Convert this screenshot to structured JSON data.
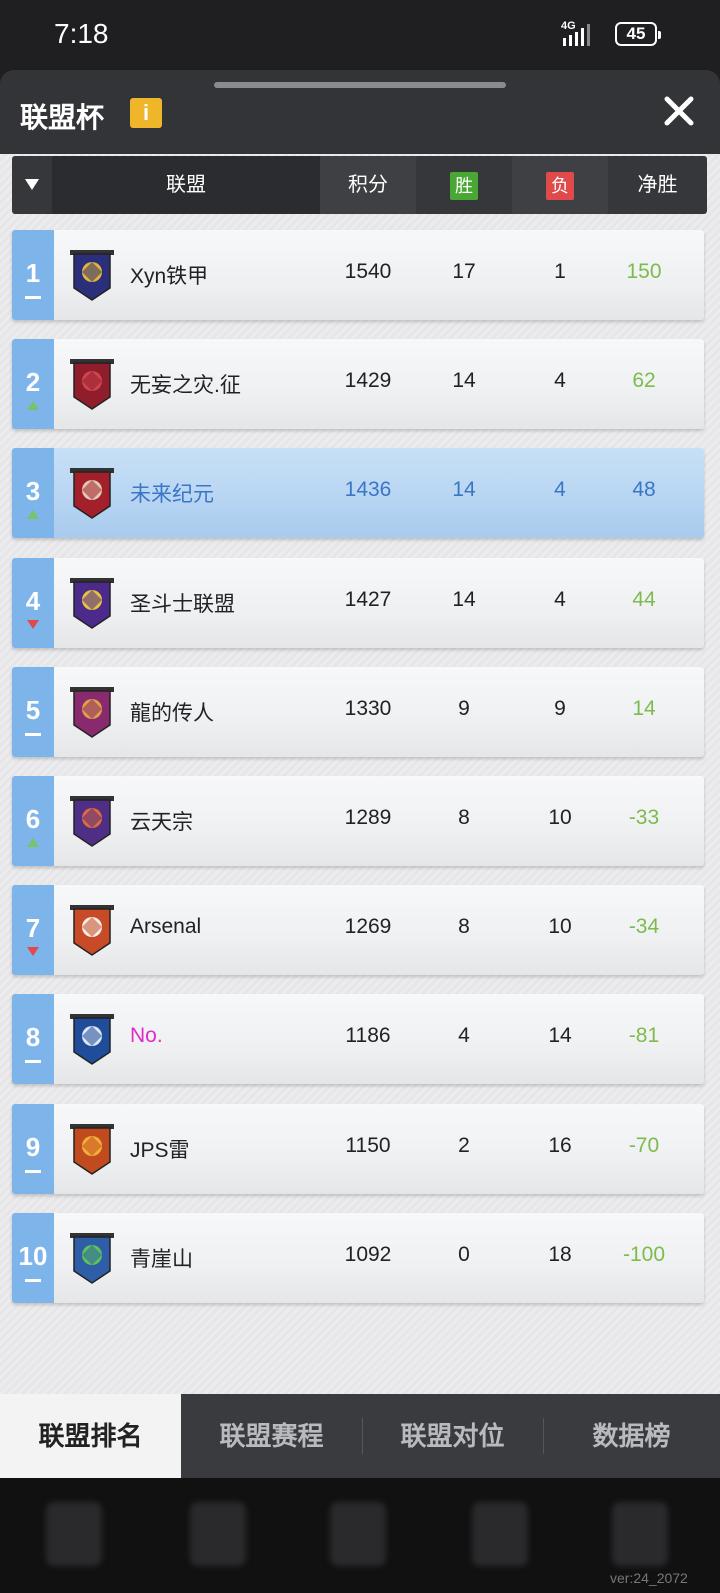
{
  "status": {
    "time": "7:18",
    "network": "4G",
    "battery": "45"
  },
  "header": {
    "title": "联盟杯",
    "info_icon": "i"
  },
  "table": {
    "columns": {
      "league": "联盟",
      "score": "积分",
      "win": "胜",
      "loss": "负",
      "net": "净胜"
    },
    "rows": [
      {
        "rank": "1",
        "trend": "same",
        "name": "Xyn铁甲",
        "score": "1540",
        "win": "17",
        "loss": "1",
        "net": "150",
        "emblem": "navy-gold-banner"
      },
      {
        "rank": "2",
        "trend": "up",
        "name": "无妄之灾.征",
        "score": "1429",
        "win": "14",
        "loss": "4",
        "net": "62",
        "emblem": "crimson-banner"
      },
      {
        "rank": "3",
        "trend": "up",
        "name": "未来纪元",
        "score": "1436",
        "win": "14",
        "loss": "4",
        "net": "48",
        "emblem": "red-banner"
      },
      {
        "rank": "4",
        "trend": "down",
        "name": "圣斗士联盟",
        "score": "1427",
        "win": "14",
        "loss": "4",
        "net": "44",
        "emblem": "purple-gold-banner"
      },
      {
        "rank": "5",
        "trend": "same",
        "name": "龍的传人",
        "score": "1330",
        "win": "9",
        "loss": "9",
        "net": "14",
        "emblem": "magenta-banner"
      },
      {
        "rank": "6",
        "trend": "up",
        "name": "云天宗",
        "score": "1289",
        "win": "8",
        "loss": "10",
        "net": "-33",
        "emblem": "violet-banner"
      },
      {
        "rank": "7",
        "trend": "down",
        "name": "Arsenal",
        "score": "1269",
        "win": "8",
        "loss": "10",
        "net": "-34",
        "emblem": "orange-shield"
      },
      {
        "rank": "8",
        "trend": "same",
        "name": "No.",
        "score": "1186",
        "win": "4",
        "loss": "14",
        "net": "-81",
        "emblem": "blue-banner"
      },
      {
        "rank": "9",
        "trend": "same",
        "name": "JPS雷",
        "score": "1150",
        "win": "2",
        "loss": "16",
        "net": "-70",
        "emblem": "orange-banner"
      },
      {
        "rank": "10",
        "trend": "same",
        "name": "青崖山",
        "score": "1092",
        "win": "0",
        "loss": "18",
        "net": "-100",
        "emblem": "blue-green-banner"
      }
    ]
  },
  "tabs": [
    "联盟排名",
    "联盟赛程",
    "联盟对位",
    "数据榜"
  ],
  "footer": {
    "version": "ver:24_2072"
  },
  "colors": {
    "rank_bg": "#7db4ea",
    "net_text": "#7dbb4e",
    "highlight_text": "#3b76c6",
    "win_tag": "#49a833",
    "loss_tag": "#e04a4a"
  }
}
